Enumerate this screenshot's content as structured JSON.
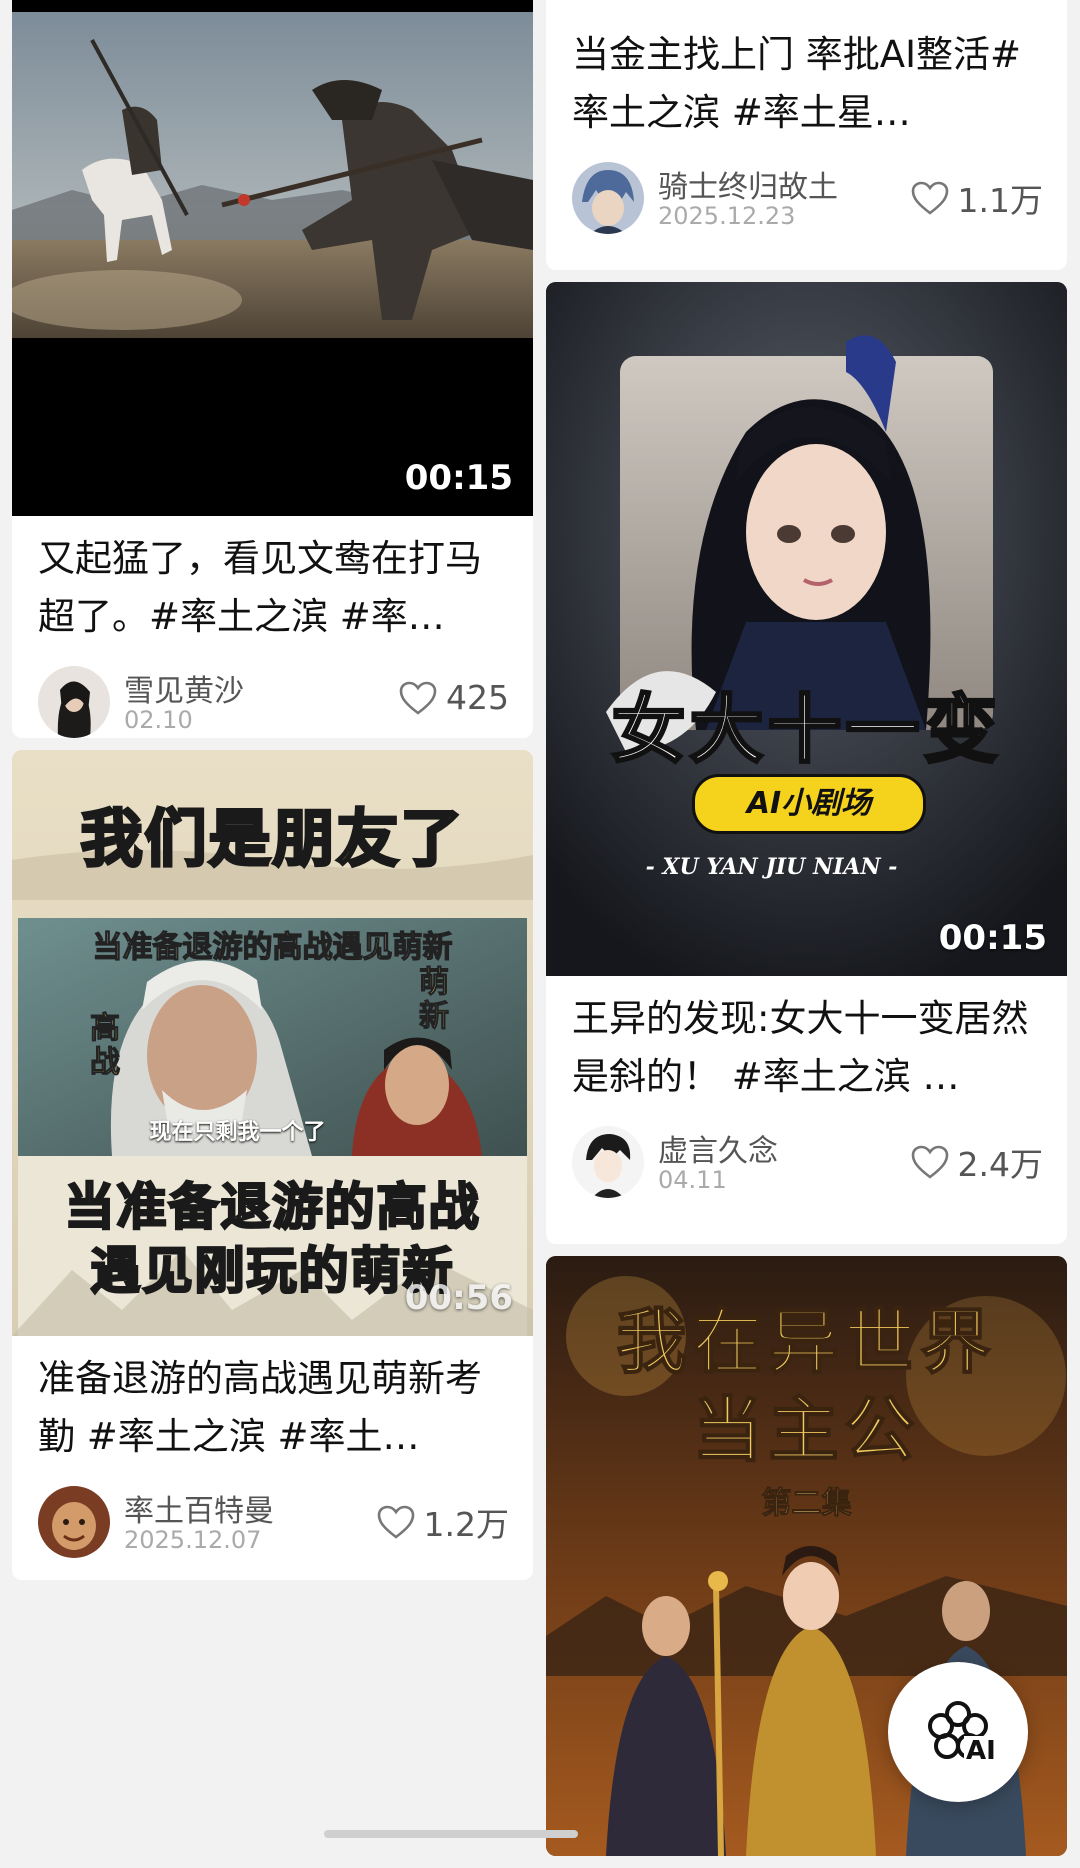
{
  "feed": {
    "left": [
      {
        "duration": "00:15",
        "title": "又起猛了，看见文鸯在打马超了。#率土之滨 #率…",
        "author": "雪见黄沙",
        "date": "02.10",
        "likes": "425"
      },
      {
        "thumb_top_text": "我们是朋友了",
        "thumb_caption_top": "当准备退游的高战遇见萌新",
        "thumb_label_left": "高战",
        "thumb_label_right": "萌新",
        "thumb_subtitle": "现在只剩我一个了",
        "thumb_bottom_text": "当准备退游的高战遇见刚玩的萌新",
        "duration": "00:56",
        "title": "准备退游的高战遇见萌新考勤 #率土之滨 #率土…",
        "author": "率土百特曼",
        "date": "2025.12.07",
        "likes": "1.2万"
      }
    ],
    "right": [
      {
        "title": "当金主找上门  率批AI整活#率土之滨 #率土星…",
        "author": "骑士终归故土",
        "date": "2025.12.23",
        "likes": "1.1万"
      },
      {
        "thumb_title": "女大十一变",
        "thumb_badge": "AI小剧场",
        "thumb_subtitle": "- XU  YAN  JIU  NIAN -",
        "duration": "00:15",
        "title": "王异的发现:女大十一变居然是斜的！ #率土之滨 …",
        "author": "虚言久念",
        "date": "04.11",
        "likes": "2.4万"
      },
      {
        "thumb_title": "我在异世界当主公",
        "thumb_episode": "第二集"
      }
    ]
  },
  "fab": {
    "label": "AI",
    "icon": "ai-flower-icon"
  },
  "colors": {
    "background": "#f2f2f2",
    "card": "#ffffff",
    "badge_yellow": "#f5d31c",
    "gold_text": "#e8c15a"
  }
}
